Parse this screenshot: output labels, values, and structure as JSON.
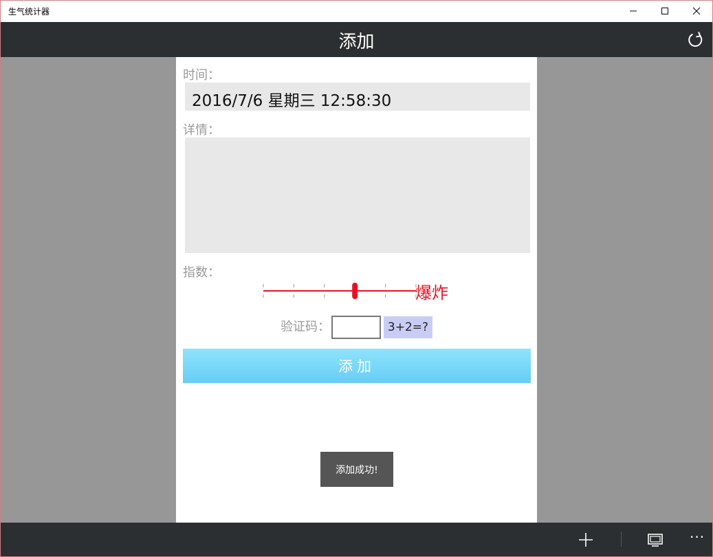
{
  "window": {
    "title": "生气统计器"
  },
  "header": {
    "title": "添加",
    "refresh_icon": "refresh-icon"
  },
  "form": {
    "time_label": "时间：",
    "time_value": "2016/7/6 星期三 12:58:30",
    "detail_label": "详情：",
    "detail_value": "",
    "index_label": "指数：",
    "index_level_text": "爆炸",
    "index_value_fraction": 0.6,
    "index_tick_count": 6,
    "captcha_label": "验证码：",
    "captcha_value": "",
    "captcha_question": "3+2=?",
    "submit_label": "添加"
  },
  "toast": {
    "message": "添加成功!"
  },
  "commandbar": {
    "icons": [
      "add-icon",
      "display-icon",
      "more-icon"
    ],
    "more_label": "···"
  },
  "colors": {
    "header_bg": "#2b2f31",
    "accent_red": "#e81123",
    "button_bg": "#7dd8f8",
    "captcha_bg": "#c9cdf5"
  }
}
